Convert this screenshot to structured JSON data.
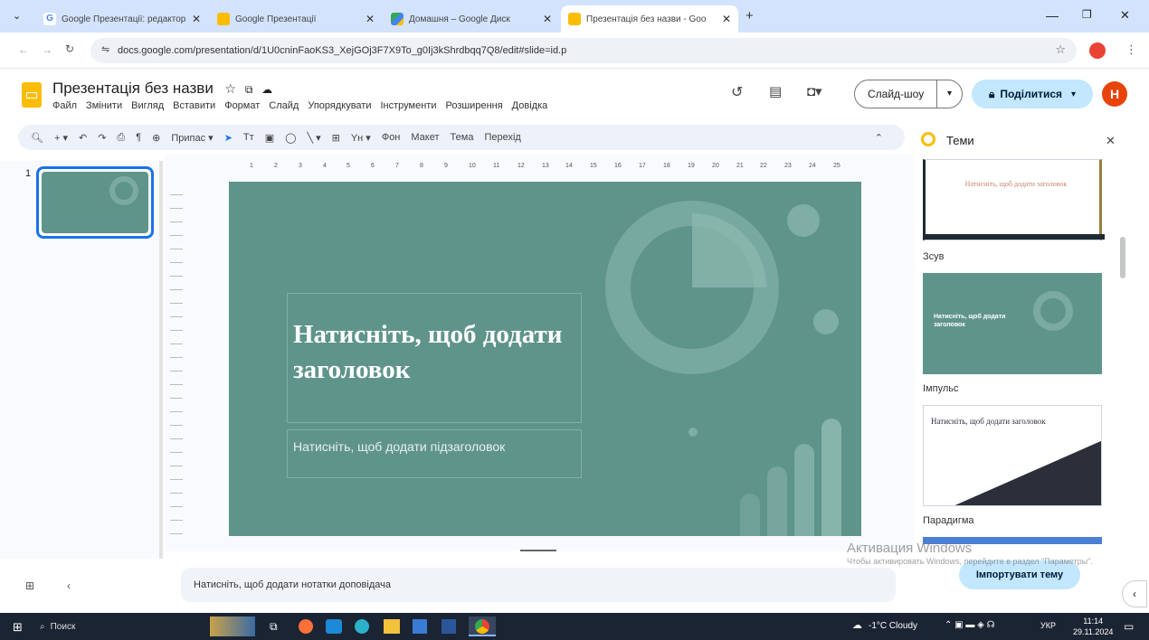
{
  "browser": {
    "tabs": [
      {
        "label": "Google Презентації: редактор",
        "color": "#fbbc04"
      },
      {
        "label": "Google Презентації",
        "color": "#fbbc04"
      },
      {
        "label": "Домашня – Google Диск",
        "color": "#34a853"
      },
      {
        "label": "Презентація без назви - Goo",
        "color": "#fbbc04"
      }
    ],
    "url": "docs.google.com/presentation/d/1U0cninFaoKS3_XejGOj3F7X9To_g0Ij3kShrdbqq7Q8/edit#slide=id.p"
  },
  "docs": {
    "title": "Презентація без назви",
    "menu": [
      "Файл",
      "Змінити",
      "Вигляд",
      "Вставити",
      "Формат",
      "Слайд",
      "Упорядкувати",
      "Інструменти",
      "Розширення",
      "Довідка"
    ],
    "toolbar": {
      "fit_label": "Припас",
      "items": [
        "Фон",
        "Макет",
        "Тема",
        "Перехід"
      ]
    },
    "slideshow_label": "Слайд-шоу",
    "share_label": "Поділитися",
    "avatar_letter": "Н"
  },
  "filmstrip": {
    "slide_number": "1"
  },
  "ruler": {
    "ticks": [
      "1",
      "2",
      "3",
      "4",
      "5",
      "6",
      "7",
      "8",
      "9",
      "10",
      "11",
      "12",
      "13",
      "14",
      "15",
      "16",
      "17",
      "18",
      "19",
      "20",
      "21",
      "22",
      "23",
      "24",
      "25"
    ]
  },
  "slide": {
    "title": "Натисніть, щоб додати заголовок",
    "subtitle": "Натисніть, щоб додати підзаголовок",
    "bg_color": "#5f948b"
  },
  "notes_placeholder": "Натисніть, щоб додати нотатки доповідача",
  "themes_panel": {
    "title": "Теми",
    "themes": [
      {
        "name": "Зсув",
        "preview_title": "Натисніть, щоб додати заголовок"
      },
      {
        "name": "Імпульс",
        "preview_title": "Натисніть, щоб додати заголовок"
      },
      {
        "name": "Парадигма",
        "preview_title": "Натисніть, щоб додати заголовок"
      }
    ],
    "import_label": "Імпортувати тему"
  },
  "windows_activation": {
    "title": "Активация Windows",
    "message": "Чтобы активировать Windows, перейдите в раздел \"Параметры\"."
  },
  "taskbar": {
    "search_label": "Поиск",
    "weather": "-1°C Cloudy",
    "language": "УКР",
    "time": "11:14",
    "date": "29.11.2024"
  }
}
